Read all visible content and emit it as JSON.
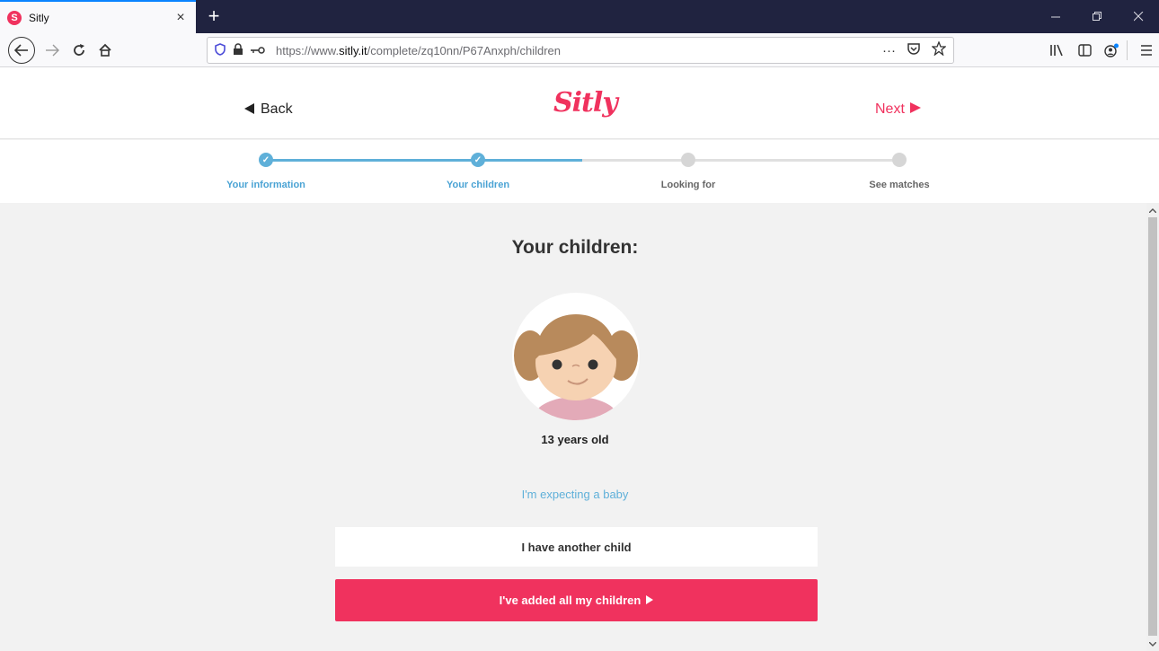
{
  "browser": {
    "tab_title": "Sitly",
    "tab_favicon": "S",
    "tab_close": "×",
    "new_tab": "+",
    "url_prefix": "https://www.",
    "url_domain": "sitly.it",
    "url_path": "/complete/zq10nn/P67Anxph/children",
    "url_more": "···"
  },
  "header": {
    "back_label": "Back",
    "logo_text": "Sitly",
    "next_label": "Next"
  },
  "stepper": {
    "steps": [
      {
        "label": "Your information",
        "state": "done"
      },
      {
        "label": "Your children",
        "state": "done"
      },
      {
        "label": "Looking for",
        "state": "todo"
      },
      {
        "label": "See matches",
        "state": "todo"
      }
    ]
  },
  "main": {
    "title": "Your children:",
    "child_age": "13 years old",
    "expecting_link": "I'm expecting a baby",
    "another_child_button": "I have another child",
    "all_added_button": "I've added all my children"
  },
  "colors": {
    "brand": "#f0325e",
    "step_active": "#5fb0d9",
    "step_inactive": "#d6d6d6"
  }
}
